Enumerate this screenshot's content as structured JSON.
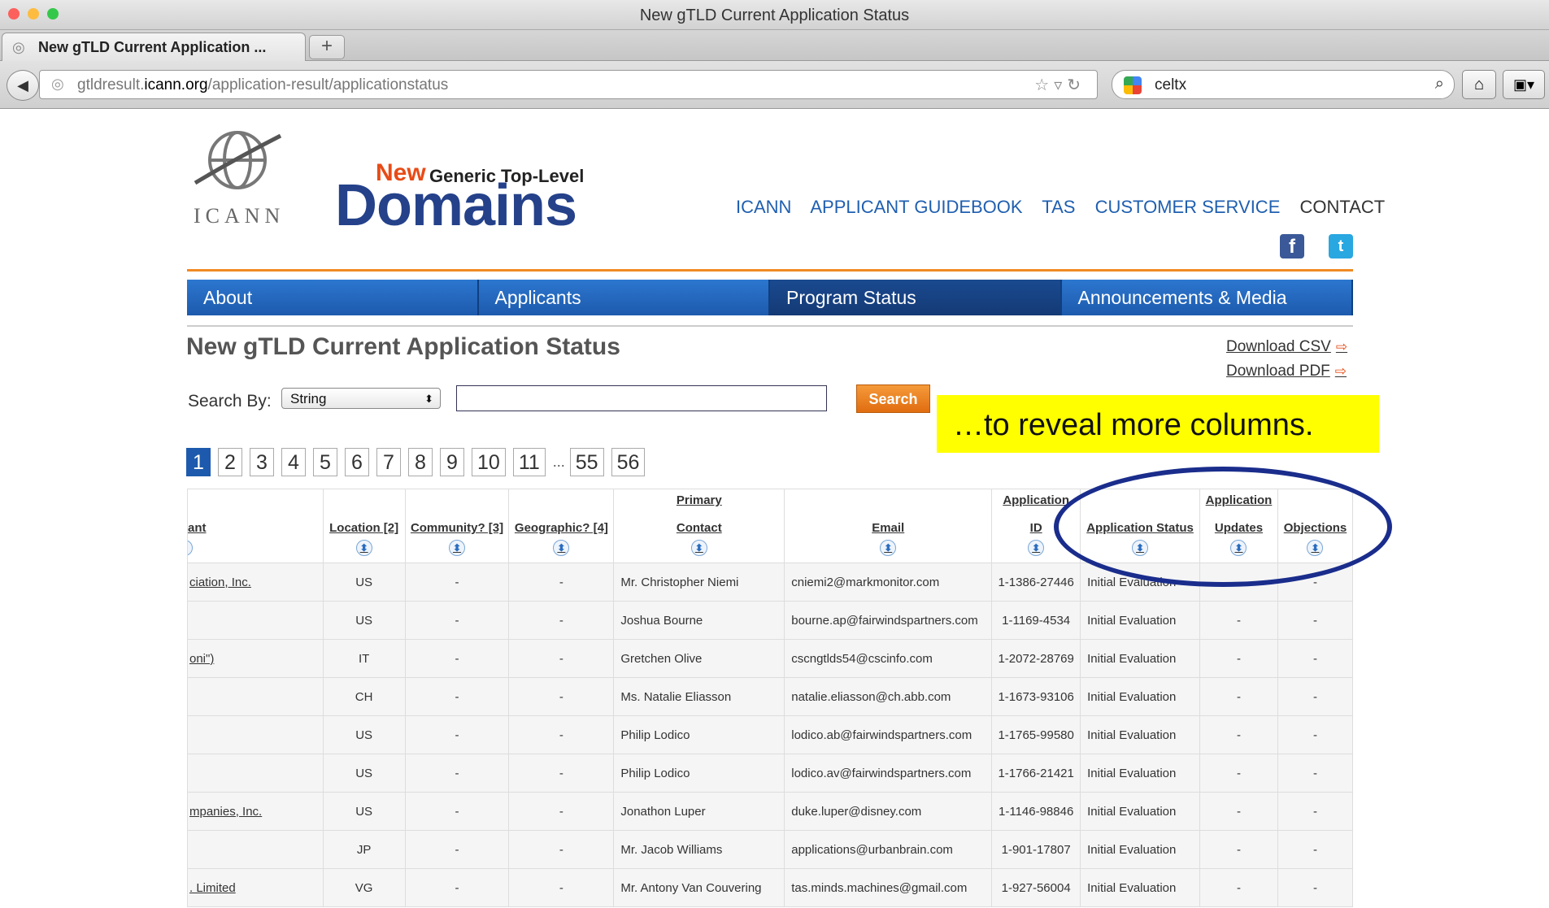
{
  "window": {
    "title": "New gTLD Current Application Status"
  },
  "tab": {
    "label": "New gTLD Current Application ..."
  },
  "url": {
    "host": "gtldresult.",
    "domain": "icann.org",
    "path": "/application-result/applicationstatus"
  },
  "browser_search": {
    "value": "celtx"
  },
  "logo": {
    "icann": "ICANN",
    "new": "New",
    "generic": "Generic Top-Level",
    "domains": "Domains"
  },
  "topnav": [
    "ICANN",
    "APPLICANT GUIDEBOOK",
    "TAS",
    "CUSTOMER SERVICE",
    "CONTACT"
  ],
  "mainnav": [
    "About",
    "Applicants",
    "Program Status",
    "Announcements & Media"
  ],
  "page_title": "New gTLD Current Application Status",
  "downloads": {
    "csv": "Download CSV",
    "pdf": "Download PDF"
  },
  "search": {
    "label": "Search By:",
    "select_value": "String",
    "input_value": "",
    "button": "Search"
  },
  "callout": "…to reveal more columns.",
  "pagination": {
    "current": "1",
    "pages": [
      "2",
      "3",
      "4",
      "5",
      "6",
      "7",
      "8",
      "9",
      "10",
      "11"
    ],
    "ellipsis": "...",
    "last": [
      "55",
      "56"
    ]
  },
  "table": {
    "headers": {
      "applicant": "ant",
      "location": "Location [2]",
      "community": "Community? [3]",
      "geographic": "Geographic? [4]",
      "contact_1": "Primary",
      "contact_2": "Contact",
      "email": "Email",
      "appid_1": "Application",
      "appid_2": "ID",
      "status": "Application Status",
      "updates_1": "Application",
      "updates_2": "Updates",
      "objections": "Objections"
    },
    "rows": [
      [
        "ciation, Inc.",
        "US",
        "-",
        "-",
        "Mr. Christopher Niemi",
        "cniemi2@markmonitor.com",
        "1-1386-27446",
        "Initial Evaluation",
        "-",
        "-"
      ],
      [
        "",
        "US",
        "-",
        "-",
        "Joshua Bourne",
        "bourne.ap@fairwindspartners.com",
        "1-1169-4534",
        "Initial Evaluation",
        "-",
        "-"
      ],
      [
        "oni\")",
        "IT",
        "-",
        "-",
        "Gretchen Olive",
        "cscngtlds54@cscinfo.com",
        "1-2072-28769",
        "Initial Evaluation",
        "-",
        "-"
      ],
      [
        "",
        "CH",
        "-",
        "-",
        "Ms. Natalie Eliasson",
        "natalie.eliasson@ch.abb.com",
        "1-1673-93106",
        "Initial Evaluation",
        "-",
        "-"
      ],
      [
        "",
        "US",
        "-",
        "-",
        "Philip Lodico",
        "lodico.ab@fairwindspartners.com",
        "1-1765-99580",
        "Initial Evaluation",
        "-",
        "-"
      ],
      [
        "",
        "US",
        "-",
        "-",
        "Philip Lodico",
        "lodico.av@fairwindspartners.com",
        "1-1766-21421",
        "Initial Evaluation",
        "-",
        "-"
      ],
      [
        "mpanies, Inc.",
        "US",
        "-",
        "-",
        "Jonathon Luper",
        "duke.luper@disney.com",
        "1-1146-98846",
        "Initial Evaluation",
        "-",
        "-"
      ],
      [
        "",
        "JP",
        "-",
        "-",
        "Mr. Jacob Williams",
        "applications@urbanbrain.com",
        "1-901-17807",
        "Initial Evaluation",
        "-",
        "-"
      ],
      [
        ". Limited",
        "VG",
        "-",
        "-",
        "Mr. Antony Van Couvering",
        "tas.minds.machines@gmail.com",
        "1-927-56004",
        "Initial Evaluation",
        "-",
        "-"
      ]
    ]
  },
  "colors": {
    "accent_orange": "#f08a24",
    "nav_blue": "#1d5aad",
    "logo_blue": "#24418a",
    "callout_yellow": "#ffff00",
    "circle_blue": "#1a2d8c"
  }
}
